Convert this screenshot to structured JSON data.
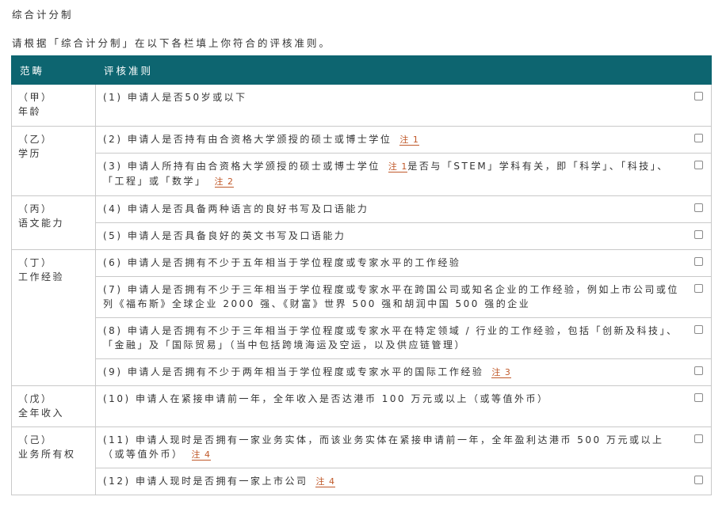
{
  "section_title": "综合计分制",
  "instruction": "请根据「综合计分制」在以下各栏填上你符合的评核准则。",
  "table": {
    "headers": {
      "category": "范畴",
      "criteria": "评核准则"
    },
    "rows": [
      {
        "cat1": "（甲）",
        "cat2": "年龄",
        "items": [
          {
            "text": "(1) 申请人是否50岁或以下",
            "note": ""
          }
        ]
      },
      {
        "cat1": "（乙）",
        "cat2": "学历",
        "items": [
          {
            "text": "(2) 申请人是否持有由合资格大学颁授的硕士或博士学位",
            "note": "注 1"
          },
          {
            "text": "(3) 申请人所持有由合资格大学颁授的硕士或博士学位",
            "note": "注 1",
            "text2": "是否与「STEM」学科有关，即「科学」、「科技」、「工程」或「数学」",
            "note2": "注 2"
          }
        ]
      },
      {
        "cat1": "（丙）",
        "cat2": "语文能力",
        "items": [
          {
            "text": "(4) 申请人是否具备两种语言的良好书写及口语能力",
            "note": ""
          },
          {
            "text": "(5) 申请人是否具备良好的英文书写及口语能力",
            "note": ""
          }
        ]
      },
      {
        "cat1": "（丁）",
        "cat2": "工作经验",
        "items": [
          {
            "text": "(6) 申请人是否拥有不少于五年相当于学位程度或专家水平的工作经验",
            "note": ""
          },
          {
            "text": "(7) 申请人是否拥有不少于三年相当于学位程度或专家水平在跨国公司或知名企业的工作经验，例如上市公司或位列《福布斯》全球企业 2000 强、《财富》世界 500 强和胡润中国 500 强的企业",
            "note": ""
          },
          {
            "text": "(8) 申请人是否拥有不少于三年相当于学位程度或专家水平在特定领域 / 行业的工作经验，包括「创新及科技」、「金融」及「国际贸易」（当中包括跨境海运及空运，以及供应链管理）",
            "note": ""
          },
          {
            "text": "(9) 申请人是否拥有不少于两年相当于学位程度或专家水平的国际工作经验",
            "note": "注 3"
          }
        ]
      },
      {
        "cat1": "（戊）",
        "cat2": "全年收入",
        "items": [
          {
            "text": "(10) 申请人在紧接申请前一年，全年收入是否达港币 100 万元或以上（或等值外币）",
            "note": ""
          }
        ]
      },
      {
        "cat1": "（己）",
        "cat2": "业务所有权",
        "items": [
          {
            "text": "(11) 申请人现时是否拥有一家业务实体，而该业务实体在紧接申请前一年，全年盈利达港币 500 万元或以上（或等值外币）",
            "note": "注 4"
          },
          {
            "text": "(12) 申请人现时是否拥有一家上市公司",
            "note": "注 4"
          }
        ]
      }
    ]
  }
}
